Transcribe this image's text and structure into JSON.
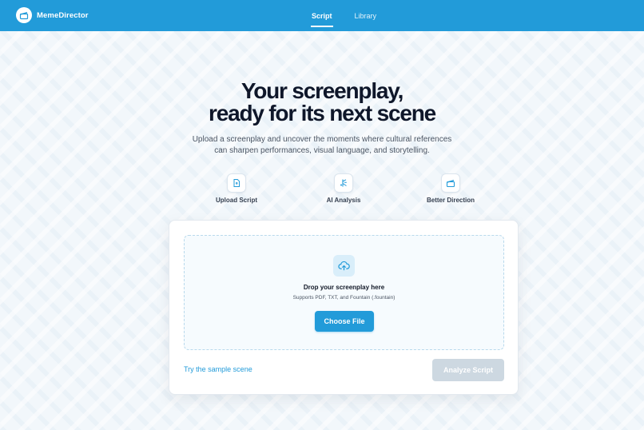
{
  "app": {
    "name": "MemeDirector",
    "logo_icon": "clapperboard-icon"
  },
  "nav": {
    "tabs": [
      {
        "label": "Script",
        "active": true
      },
      {
        "label": "Library",
        "active": false
      }
    ]
  },
  "hero": {
    "title_line1": "Your screenplay,",
    "title_line2": "ready for its next scene",
    "subtitle_line1": "Upload a screenplay and uncover the moments where cultural references",
    "subtitle_line2": "can sharpen performances, visual language, and storytelling."
  },
  "features": [
    {
      "label": "Upload Script",
      "icon": "file-icon"
    },
    {
      "label": "AI Analysis",
      "icon": "ai-analysis-icon"
    },
    {
      "label": "Better Direction",
      "icon": "clapperboard-icon"
    }
  ],
  "upload": {
    "icon": "upload-cloud-icon",
    "title": "Drop your screenplay here",
    "hint": "Supports PDF, TXT, and Fountain (.fountain)",
    "choose_label": "Choose File"
  },
  "actions": {
    "sample_link": "Try the sample scene",
    "analyze_label": "Analyze Script",
    "analyze_disabled": true
  },
  "colors": {
    "brand": "#229bd9",
    "background": "#f2f7fb",
    "disabled_button": "#cdd8e1",
    "heading": "#0f172a"
  }
}
